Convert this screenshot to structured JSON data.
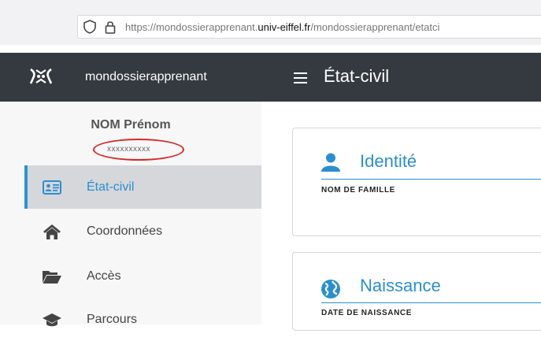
{
  "browser": {
    "url_prefix": "https://mondossierapprenant.",
    "url_domain": "univ-eiffel.fr",
    "url_suffix": "/mondossierapprenant/etatci"
  },
  "navbar": {
    "app_name": "mondossierapprenant",
    "page_title": "État-civil"
  },
  "user": {
    "name": "NOM Prénom",
    "id": "xxxxxxxxxx"
  },
  "sidebar": {
    "items": [
      {
        "label": "État-civil",
        "icon": "id-card-icon",
        "active": true
      },
      {
        "label": "Coordonnées",
        "icon": "home-icon",
        "active": false
      },
      {
        "label": "Accès",
        "icon": "folder-open-icon",
        "active": false
      },
      {
        "label": "Parcours",
        "icon": "graduation-cap-icon",
        "active": false
      }
    ]
  },
  "cards": [
    {
      "title": "Identité",
      "icon": "user-icon",
      "fields": [
        "NOM DE FAMILLE"
      ]
    },
    {
      "title": "Naissance",
      "icon": "globe-icon",
      "fields": [
        "DATE DE NAISSANCE"
      ]
    }
  ],
  "colors": {
    "navbar_bg": "#343a40",
    "accent": "#2a8fcf",
    "annotation_circle": "#d62828"
  }
}
